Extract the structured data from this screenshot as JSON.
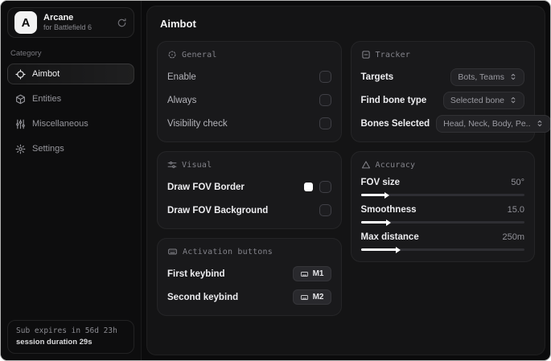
{
  "app": {
    "logo_letter": "A",
    "name": "Arcane",
    "subtitle": "for Battlefield 6"
  },
  "sidebar": {
    "category_label": "Category",
    "items": [
      {
        "label": "Aimbot",
        "icon": "crosshair-icon",
        "selected": true
      },
      {
        "label": "Entities",
        "icon": "cube-icon",
        "selected": false
      },
      {
        "label": "Miscellaneous",
        "icon": "mixer-icon",
        "selected": false
      },
      {
        "label": "Settings",
        "icon": "gear-icon",
        "selected": false
      }
    ],
    "subscription": {
      "expires": "Sub expires in 56d 23h",
      "session": "session duration 29s"
    }
  },
  "main": {
    "title": "Aimbot",
    "general": {
      "title": "General",
      "rows": [
        {
          "label": "Enable",
          "control": "checkbox",
          "checked": false
        },
        {
          "label": "Always",
          "control": "checkbox",
          "checked": false
        },
        {
          "label": "Visibility check",
          "control": "checkbox",
          "checked": false
        }
      ]
    },
    "visual": {
      "title": "Visual",
      "rows": [
        {
          "label": "Draw FOV Border",
          "control": "checkbox",
          "checked": false,
          "swatch_color": "#ffffff"
        },
        {
          "label": "Draw FOV Background",
          "control": "checkbox",
          "checked": false
        }
      ]
    },
    "activation": {
      "title": "Activation buttons",
      "rows": [
        {
          "label": "First keybind",
          "key": "M1"
        },
        {
          "label": "Second keybind",
          "key": "M2"
        }
      ]
    },
    "tracker": {
      "title": "Tracker",
      "rows": [
        {
          "label": "Targets",
          "value": "Bots, Teams"
        },
        {
          "label": "Find bone type",
          "value": "Selected bone"
        },
        {
          "label": "Bones Selected",
          "value": "Head, Neck, Body, Pe.."
        }
      ]
    },
    "accuracy": {
      "title": "Accuracy",
      "sliders": [
        {
          "label": "FOV size",
          "value": "50°",
          "fill_pct": 15
        },
        {
          "label": "Smoothness",
          "value": "15.0",
          "fill_pct": 16
        },
        {
          "label": "Max distance",
          "value": "250m",
          "fill_pct": 22
        }
      ]
    }
  },
  "colors": {
    "accent": "#ffffff",
    "fov_border_swatch": "#ffffff"
  }
}
